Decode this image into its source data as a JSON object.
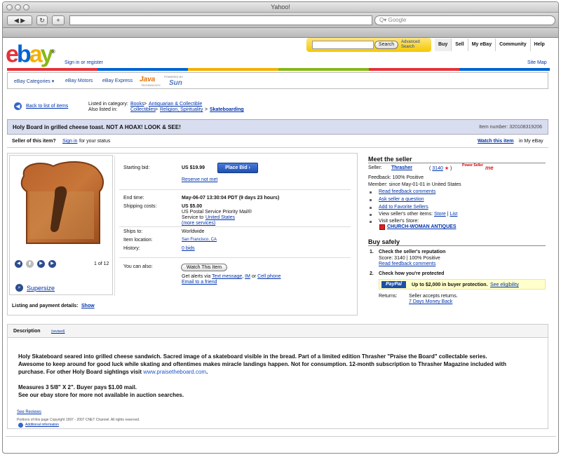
{
  "window": {
    "title": "Yahoo!"
  },
  "browser": {
    "search_placeholder": "Google",
    "search_glyph": "Q▾"
  },
  "header": {
    "logo": {
      "e": "e",
      "b": "b",
      "a": "a",
      "y": "y",
      "trademark": "®"
    },
    "signin": "Sign in or register",
    "search_button": "Search",
    "advanced_search": "Advanced Search",
    "nav": [
      "Buy",
      "Sell",
      "My eBay",
      "Community",
      "Help"
    ],
    "site_map": "Site Map",
    "brand_colors": [
      "#e53238",
      "#0064d2",
      "#f5af02",
      "#86b817",
      "#e53238",
      "#0064d2"
    ]
  },
  "subnav": {
    "categories": "eBay Categories ▾",
    "motors": "eBay Motors",
    "express": "eBay Express",
    "java": "Java",
    "java_sub": "TECHNOLOGY",
    "powered_by": "POWERED BY",
    "sun": "Sun"
  },
  "breadcrumb": {
    "back": "Back to list of items",
    "listed_in_label": "Listed in category:",
    "cat1": "Books",
    "cat1_sub": "Antiquarian & Collectible",
    "also_label": "Also listed in:",
    "cat2": "Collectibles",
    "cat2_sub": "Religion, Spirituality",
    "cat2_sub2": "Skateboarding"
  },
  "item": {
    "title": "Holy Board in grilled cheese toast. NOT A HOAX! LOOK & SEE!",
    "number": "Item number: 320108319206",
    "seller_prompt_1": "Seller of this item?",
    "seller_prompt_link": "Sign in",
    "seller_prompt_2": "for your status",
    "watch_link": "Watch this item",
    "watch_suffix": "in My eBay"
  },
  "listing": {
    "starting_bid_label": "Starting bid:",
    "starting_bid": "US $19.99",
    "place_bid": "Place Bid ›",
    "reserve": "Reserve not met",
    "end_time_label": "End time:",
    "end_time": "May-06-07 13:30:04 PDT (9 days 23 hours)",
    "shipping_label": "Shipping costs:",
    "shipping_cost": "US $5.00",
    "shipping_service": "US Postal Service Priority Mail®",
    "service_to": "Service to",
    "service_to_link": "United States",
    "more_services": "(more services)",
    "ships_to_label": "Ships to:",
    "ships_to": "Worldwide",
    "location_label": "Item location:",
    "location": "San Francisco, CA",
    "history_label": "History:",
    "history": "0 bids",
    "can_also_label": "You can also:",
    "watch_button": "Watch This Item",
    "alerts_prefix": "Get alerts via",
    "alerts_text": "Text message",
    "alerts_im": "IM",
    "alerts_or": "or",
    "alerts_phone": "Cell phone",
    "email_friend": "Email to a friend",
    "photo_count": "1 of 12",
    "supersize": "Supersize",
    "payment_label": "Listing and payment details:",
    "payment_link": "Show"
  },
  "seller": {
    "title": "Meet the seller",
    "seller_label": "Seller:",
    "seller_name": "Thrasher",
    "score": "3140",
    "power_label": "Power Seller",
    "me_label": "me",
    "feedback": "Feedback: 100% Positive",
    "member": "Member: since May-01-01 in United States",
    "links": [
      "Read feedback comments",
      "Ask seller a question",
      "Add to Favorite Sellers"
    ],
    "view_other": "View seller's other items:",
    "store_link": "Store",
    "list_link": "List",
    "visit_store": "Visit seller's Store:",
    "store_name": "CHURCH-WOMAN ANTIQUES"
  },
  "buy_safely": {
    "title": "Buy safely",
    "step1_num": "1.",
    "step1": "Check the seller's reputation",
    "step1_score": "Score: 3140 | 100% Positive",
    "step1_link": "Read feedback comments",
    "step2_num": "2.",
    "step2": "Check how you're protected",
    "paypal": "PayPal",
    "paypal_text": "Up to $2,000 in buyer protection.",
    "paypal_link": "See eligibility",
    "returns_label": "Returns:",
    "returns": "Seller accepts returns.",
    "returns_link": "7 Days Money Back"
  },
  "description": {
    "tab": "Description",
    "revised": "(revised)",
    "p1": "Holy Skateboard seared into grilled cheese sandwich. Sacred image of a skateboard visible in the bread. Part of a limited edition Thrasher \"Praise the Board\" collectable series.",
    "p2": "Awesome to keep around for good luck while skating and oftentimes makes miracle landings happen. Not for consumption. 12-month subscription to Thrasher Magazine included with",
    "p3": "purchase. For other Holy Board sightings visit",
    "p3_url": "www.praisetheboard.com",
    "p3_end": ".",
    "p4": "Measures 3 5/8\" X 2\". Buyer pays $1.00 mail.",
    "p5": "See our ebay store for more not available in auction searches.",
    "reviews": "See Reviews",
    "copyright": "Portions of this page Copyright 1997 - 2007 CNET Channel. All rights reserved.",
    "additional": "Additional information"
  }
}
